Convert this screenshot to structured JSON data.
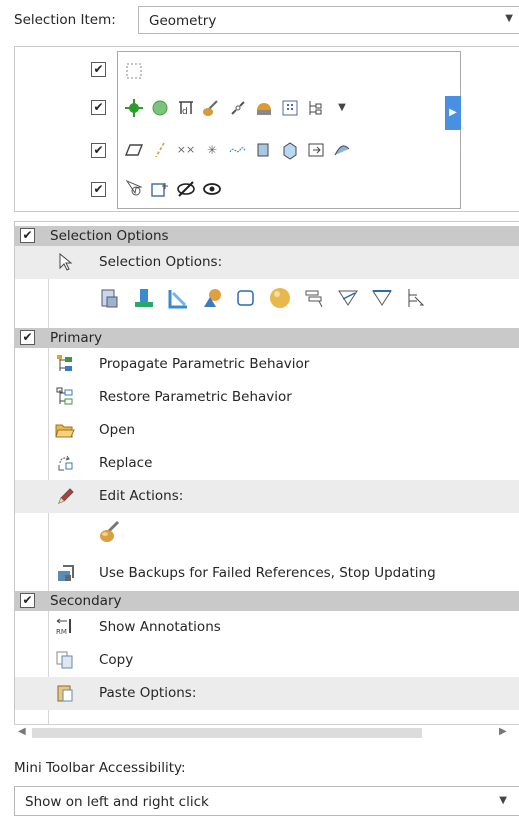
{
  "selection_item": {
    "label": "Selection Item:",
    "value": "Geometry",
    "dropdown_icon": "chevron-down-icon"
  },
  "gallery": {
    "rows": [
      {
        "checked": true,
        "icons": [
          "dashed-box-select-icon"
        ]
      },
      {
        "checked": true,
        "icons": [
          "point-target-icon",
          "sphere-green-icon",
          "dimension-icon",
          "brush-icon",
          "chain-icon",
          "solid-icon",
          "grid-icon",
          "tree-icon",
          "dropdown-icon"
        ]
      },
      {
        "checked": true,
        "icons": [
          "plane-icon",
          "axis-icon",
          "coordinate-icon",
          "csys-icon",
          "curve-icon",
          "surface-icon",
          "cube-icon",
          "export-icon",
          "arrow-right-icon"
        ]
      },
      {
        "checked": true,
        "icons": [
          "zoom-select-icon",
          "insert-icon",
          "hide-icon",
          "show-icon"
        ]
      }
    ]
  },
  "sections": {
    "selection_options": {
      "header": "Selection Options",
      "checked": true,
      "sub_label": "Selection Options:"
    },
    "primary": {
      "header": "Primary",
      "checked": true,
      "items": [
        {
          "label": "Propagate Parametric Behavior",
          "icon": "propagate-icon"
        },
        {
          "label": "Restore Parametric Behavior",
          "icon": "restore-icon"
        },
        {
          "label": "Open",
          "icon": "folder-open-icon"
        },
        {
          "label": "Replace",
          "icon": "replace-icon"
        }
      ],
      "edit_actions_label": "Edit Actions:",
      "backup_label": "Use Backups for Failed References, Stop Updating"
    },
    "secondary": {
      "header": "Secondary",
      "checked": true,
      "items": [
        {
          "label": "Show Annotations",
          "icon": "annotation-icon"
        },
        {
          "label": "Copy",
          "icon": "copy-icon"
        }
      ],
      "paste_label": "Paste Options:"
    }
  },
  "mini_toolbar": {
    "label": "Mini Toolbar Accessibility:",
    "value": "Show on left and right click"
  }
}
